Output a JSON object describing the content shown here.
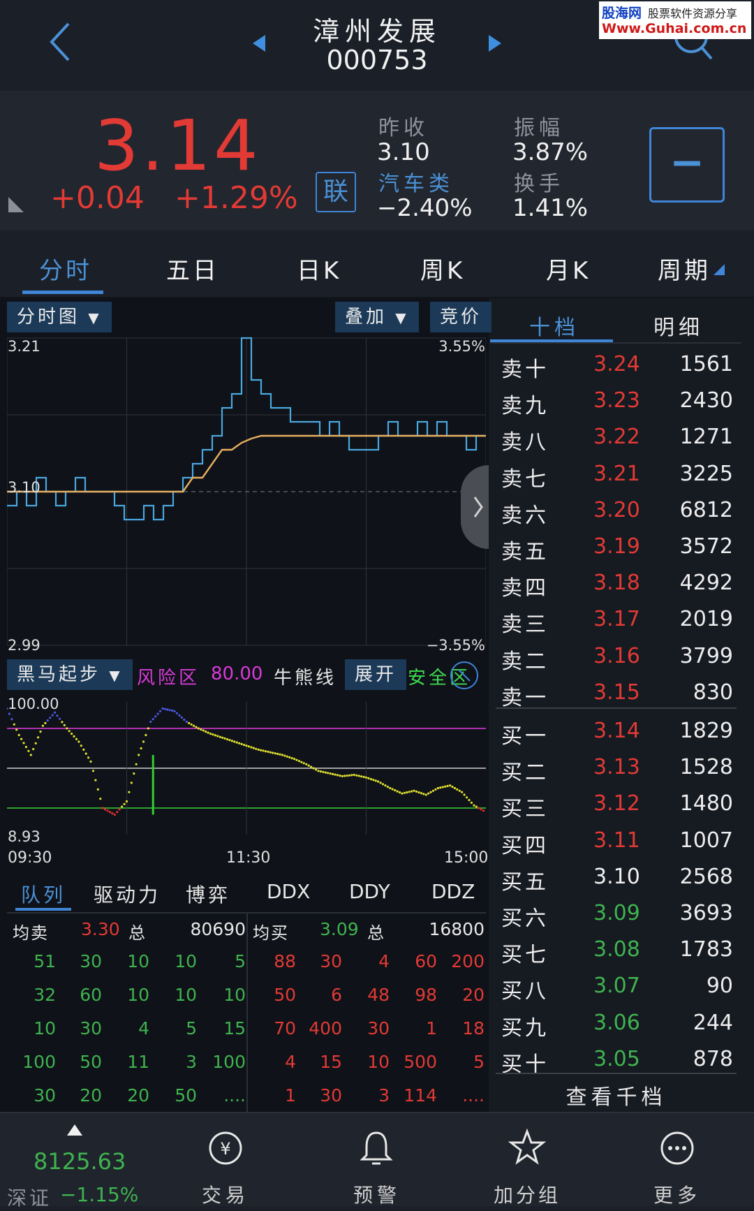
{
  "header": {
    "stock_name": "漳州发展",
    "stock_code": "000753",
    "watermark_line1": "股海网",
    "watermark_line1b": "股票软件资源分享",
    "watermark_line2": "Www.Guhai.com.cn"
  },
  "quote": {
    "price": "3.14",
    "change": "+0.04",
    "change_pct": "+1.29%",
    "lian_badge": "联",
    "prev_close_label": "昨收",
    "prev_close": "3.10",
    "sector_label": "汽车类",
    "sector_change": "−2.40%",
    "amplitude_label": "振幅",
    "amplitude": "3.87%",
    "turnover_label": "换手",
    "turnover": "1.41%",
    "minus_button": "−"
  },
  "tabs": [
    "分时",
    "五日",
    "日K",
    "周K",
    "月K",
    "周期"
  ],
  "chart_controls": {
    "chart_type": "分时图",
    "overlay": "叠加",
    "auction": "竞价"
  },
  "chart_data": [
    {
      "type": "line",
      "title": "",
      "y_left_top": "3.21",
      "y_left_mid": "3.10",
      "y_left_bottom": "2.99",
      "y_right_top": "3.55%",
      "y_right_bottom": "−3.55%",
      "ylim": [
        2.99,
        3.21
      ],
      "baseline": 3.1,
      "x_labels": [
        "09:30",
        "11:30",
        "15:00"
      ],
      "series": [
        {
          "name": "",
          "color": "#4aa8e0",
          "values": [
            3.09,
            3.1,
            3.09,
            3.11,
            3.1,
            3.09,
            3.1,
            3.11,
            3.1,
            3.1,
            3.1,
            3.09,
            3.08,
            3.08,
            3.09,
            3.08,
            3.09,
            3.1,
            3.11,
            3.12,
            3.13,
            3.14,
            3.16,
            3.17,
            3.21,
            3.18,
            3.17,
            3.16,
            3.16,
            3.15,
            3.15,
            3.15,
            3.14,
            3.15,
            3.14,
            3.13,
            3.13,
            3.13,
            3.14,
            3.15,
            3.14,
            3.14,
            3.15,
            3.14,
            3.15,
            3.14,
            3.14,
            3.13,
            3.14,
            3.14
          ]
        },
        {
          "name": "",
          "color": "#e8b060",
          "values": [
            3.1,
            3.1,
            3.1,
            3.1,
            3.1,
            3.1,
            3.1,
            3.1,
            3.1,
            3.1,
            3.1,
            3.1,
            3.1,
            3.1,
            3.1,
            3.1,
            3.1,
            3.1,
            3.1,
            3.11,
            3.11,
            3.12,
            3.13,
            3.13,
            3.135,
            3.138,
            3.14,
            3.14,
            3.14,
            3.14,
            3.14,
            3.14,
            3.14,
            3.14,
            3.14,
            3.14,
            3.14,
            3.14,
            3.14,
            3.14,
            3.14,
            3.14,
            3.14,
            3.14,
            3.14,
            3.14,
            3.14,
            3.14,
            3.14,
            3.14
          ]
        }
      ]
    },
    {
      "type": "line",
      "title": "",
      "y_top": "100.00",
      "y_bottom": "8.93",
      "ylim": [
        0,
        100
      ],
      "levels": [
        80,
        50,
        20
      ],
      "series": [
        {
          "name": "",
          "color": "#e0e030",
          "values": [
            95,
            75,
            60,
            82,
            92,
            80,
            70,
            55,
            20,
            15,
            25,
            60,
            85,
            95,
            93,
            85,
            80,
            76,
            73,
            70,
            67,
            64,
            62,
            60,
            57,
            53,
            48,
            46,
            44,
            45,
            43,
            40,
            35,
            31,
            33,
            30,
            35,
            37,
            32,
            22,
            17
          ]
        }
      ]
    }
  ],
  "indicator": {
    "name": "黑马起步",
    "risk_label": "风险区",
    "risk_value": "80.00",
    "bull_bear": "牛熊线",
    "expand": "展开",
    "safe_label": "安全区"
  },
  "order_tabs": [
    "十档",
    "明细"
  ],
  "order_book": [
    {
      "label": "卖十",
      "price": "3.24",
      "vol": "1561",
      "color": "red"
    },
    {
      "label": "卖九",
      "price": "3.23",
      "vol": "2430",
      "color": "red"
    },
    {
      "label": "卖八",
      "price": "3.22",
      "vol": "1271",
      "color": "red"
    },
    {
      "label": "卖七",
      "price": "3.21",
      "vol": "3225",
      "color": "red"
    },
    {
      "label": "卖六",
      "price": "3.20",
      "vol": "6812",
      "color": "red"
    },
    {
      "label": "卖五",
      "price": "3.19",
      "vol": "3572",
      "color": "red"
    },
    {
      "label": "卖四",
      "price": "3.18",
      "vol": "4292",
      "color": "red"
    },
    {
      "label": "卖三",
      "price": "3.17",
      "vol": "2019",
      "color": "red"
    },
    {
      "label": "卖二",
      "price": "3.16",
      "vol": "3799",
      "color": "red"
    },
    {
      "label": "卖一",
      "price": "3.15",
      "vol": "830",
      "color": "red"
    },
    {
      "label": "买一",
      "price": "3.14",
      "vol": "1829",
      "color": "red"
    },
    {
      "label": "买二",
      "price": "3.13",
      "vol": "1528",
      "color": "red"
    },
    {
      "label": "买三",
      "price": "3.12",
      "vol": "1480",
      "color": "red"
    },
    {
      "label": "买四",
      "price": "3.11",
      "vol": "1007",
      "color": "red"
    },
    {
      "label": "买五",
      "price": "3.10",
      "vol": "2568",
      "color": "white"
    },
    {
      "label": "买六",
      "price": "3.09",
      "vol": "3693",
      "color": "green"
    },
    {
      "label": "买七",
      "price": "3.08",
      "vol": "1783",
      "color": "green"
    },
    {
      "label": "买八",
      "price": "3.07",
      "vol": "90",
      "color": "green"
    },
    {
      "label": "买九",
      "price": "3.06",
      "vol": "244",
      "color": "green"
    },
    {
      "label": "买十",
      "price": "3.05",
      "vol": "878",
      "color": "green"
    }
  ],
  "view_thousand": "查看千档",
  "queue_tabs": [
    "队列",
    "驱动力",
    "博弈",
    "DDX",
    "DDY",
    "DDZ"
  ],
  "queue": {
    "avg_sell_label": "均卖",
    "avg_sell": "3.30",
    "total_label": "总",
    "sell_total": "80690",
    "avg_buy_label": "均买",
    "avg_buy": "3.09",
    "buy_total": "16800",
    "sell_rows": [
      [
        "51",
        "30",
        "10",
        "10",
        "5"
      ],
      [
        "32",
        "60",
        "10",
        "10",
        "10"
      ],
      [
        "10",
        "30",
        "4",
        "5",
        "15"
      ],
      [
        "100",
        "50",
        "11",
        "3",
        "100"
      ],
      [
        "30",
        "20",
        "20",
        "50",
        "...."
      ]
    ],
    "buy_rows": [
      [
        "88",
        "30",
        "4",
        "60",
        "200"
      ],
      [
        "50",
        "6",
        "48",
        "98",
        "20"
      ],
      [
        "70",
        "400",
        "30",
        "1",
        "18"
      ],
      [
        "4",
        "15",
        "10",
        "500",
        "5"
      ],
      [
        "1",
        "30",
        "3",
        "114",
        "...."
      ]
    ]
  },
  "bottom_nav": {
    "index_value": "8125.63",
    "index_name": "深证",
    "index_change": "−1.15%",
    "items": [
      "交易",
      "预警",
      "加分组",
      "更多"
    ]
  }
}
